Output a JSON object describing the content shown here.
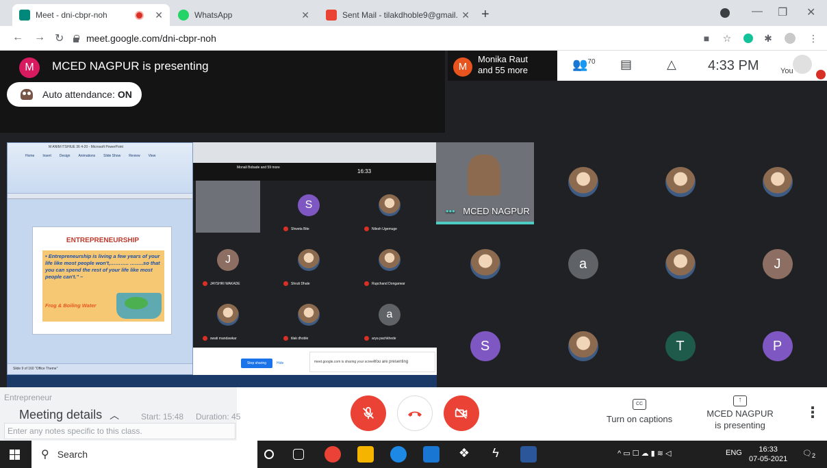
{
  "browser": {
    "tabs": [
      {
        "title": "Meet - dni-cbpr-noh",
        "active": true
      },
      {
        "title": "WhatsApp",
        "active": false
      },
      {
        "title": "Sent Mail - tilakdhoble9@gmail.c",
        "active": false
      }
    ],
    "url": "meet.google.com/dni-cbpr-noh"
  },
  "meet": {
    "presenter_initial": "M",
    "presenter_text": "MCED NAGPUR is presenting",
    "auto_attendance_label": "Auto attendance: ",
    "auto_attendance_value": "ON",
    "people_bar_initial": "M",
    "people_bar_name": "Monika Raut",
    "people_bar_more": "and 55 more",
    "participant_count": "70",
    "clock": "4:33 PM",
    "you_label": "You",
    "big_tile_label": "MCED NAGPUR",
    "grid": [
      {
        "initial": "",
        "color": "#7a8a6a",
        "photo": true
      },
      {
        "initial": "",
        "color": "#8b5e3c",
        "photo": true
      },
      {
        "initial": "",
        "color": "#b8866b",
        "photo": true
      },
      {
        "initial": "",
        "color": "#a85c4a",
        "photo": true
      },
      {
        "initial": "a",
        "color": "#5f6368",
        "photo": false
      },
      {
        "initial": "",
        "color": "#6d5a4a",
        "photo": true
      },
      {
        "initial": "J",
        "color": "#8d6e63",
        "photo": false
      },
      {
        "initial": "S",
        "color": "#7e57c2",
        "photo": false
      },
      {
        "initial": "",
        "color": "#6b7a5a",
        "photo": true
      },
      {
        "initial": "T",
        "color": "#1e5b4b",
        "photo": false
      },
      {
        "initial": "P",
        "color": "#7e57c2",
        "photo": false
      }
    ]
  },
  "shared_screen": {
    "ppt_title": "M ANIM ITSHIUE 36 4-20 - Microsoft PowerPoint",
    "ppt_menu": [
      "Home",
      "Insert",
      "Design",
      "Animations",
      "Slide Show",
      "Review",
      "View"
    ],
    "slide_heading": "ENTREPRENEURSHIP",
    "slide_text": "• Entrepreneurship is living a few years of your life like most people won't,……….. ……..so that you can spend the rest of your life like most people can't.\" –",
    "slide_frog": "Frog & Boiling Water",
    "ppt_status": "Slide 9 of 160    \"Office Theme\"",
    "inner_top_names": "Monali Bobade and 59 more",
    "inner_clock": "16:33",
    "inner_tiles": [
      {
        "name": "",
        "initial": "",
        "color": "#777",
        "video": true
      },
      {
        "name": "Shweta Bite",
        "initial": "S",
        "color": "#7e57c2",
        "video": false
      },
      {
        "name": "Nilesh Ugemuge",
        "initial": "",
        "color": "#8b6a4f",
        "video": false
      },
      {
        "name": "JAYSHRI WAKADE",
        "initial": "J",
        "color": "#8d6e63",
        "video": false
      },
      {
        "name": "Shruti Dhale",
        "initial": "",
        "color": "#7a8a6a",
        "video": false
      },
      {
        "name": "Rupchand Dongarwar",
        "initial": "",
        "color": "#8b6a4f",
        "video": false
      },
      {
        "name": "swati mandawkar",
        "initial": "",
        "color": "#a08060",
        "video": false
      },
      {
        "name": "tilak dhoble",
        "initial": "",
        "color": "#444",
        "video": false
      },
      {
        "name": "arya pachkhede",
        "initial": "a",
        "color": "#5f6368",
        "video": false
      }
    ],
    "share_notice": "meet.google.com is sharing your screen.",
    "stop_sharing": "Stop sharing",
    "hide": "Hide",
    "you_presenting": "You are presenting"
  },
  "controls": {
    "meeting_details": "Meeting details",
    "ghost_entrepreneur": "Entrepreneur",
    "ghost_start": "Start: 15:48",
    "ghost_duration": "Duration: 45",
    "notes_placeholder": "Enter any notes specific to this class.",
    "captions_label": "Turn on captions",
    "present_line1": "MCED NAGPUR",
    "present_line2": "is presenting",
    "cc_icon_text": "CC"
  },
  "taskbar": {
    "search_label": "Search",
    "lang": "ENG",
    "time": "16:33",
    "date": "07-05-2021",
    "notif_count": "2"
  }
}
